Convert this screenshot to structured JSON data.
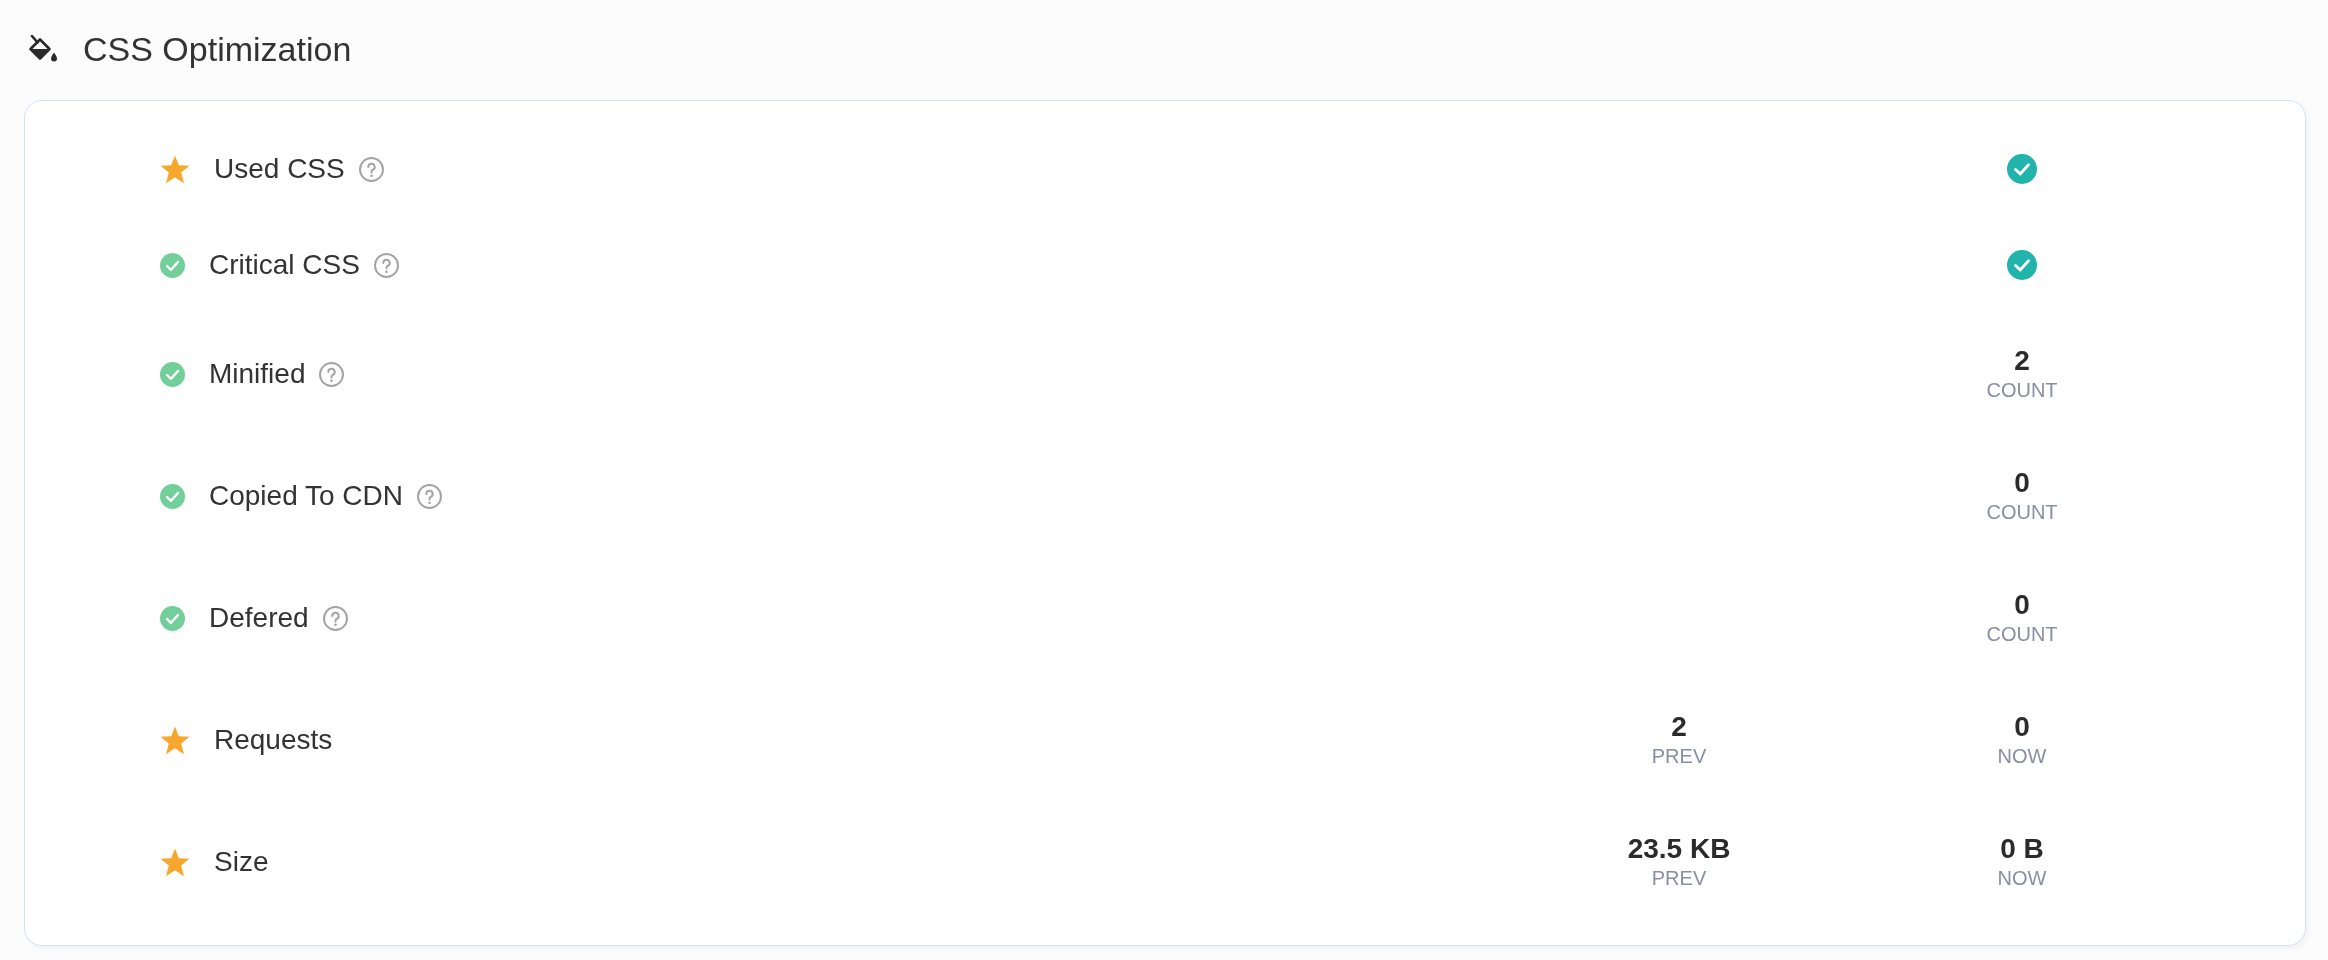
{
  "header": {
    "title": "CSS Optimization"
  },
  "metrics": [
    {
      "label": "Used CSS",
      "starred": true,
      "help": true,
      "kind": "status",
      "passed": true
    },
    {
      "label": "Critical CSS",
      "starred": false,
      "help": true,
      "kind": "status",
      "passed": true
    },
    {
      "label": "Minified",
      "starred": false,
      "help": true,
      "kind": "readings",
      "readings": [
        {
          "value": "2",
          "caption": "COUNT"
        }
      ]
    },
    {
      "label": "Copied To CDN",
      "starred": false,
      "help": true,
      "kind": "readings",
      "readings": [
        {
          "value": "0",
          "caption": "COUNT"
        }
      ]
    },
    {
      "label": "Defered",
      "starred": false,
      "help": true,
      "kind": "readings",
      "readings": [
        {
          "value": "0",
          "caption": "COUNT"
        }
      ]
    },
    {
      "label": "Requests",
      "starred": true,
      "help": false,
      "kind": "readings",
      "readings": [
        {
          "value": "2",
          "caption": "PREV"
        },
        {
          "value": "0",
          "caption": "NOW"
        }
      ]
    },
    {
      "label": "Size",
      "starred": true,
      "help": false,
      "kind": "readings",
      "readings": [
        {
          "value": "23.5 KB",
          "caption": "PREV"
        },
        {
          "value": "0 B",
          "caption": "NOW"
        }
      ]
    }
  ]
}
